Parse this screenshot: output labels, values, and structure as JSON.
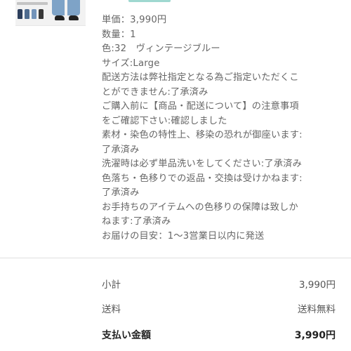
{
  "product": {
    "thumbnail_icon": "jeans-product-thumbnail",
    "unit_price": "単価：3,990円",
    "quantity": "数量：1",
    "color": "色:32　ヴィンテージブルー",
    "size": "サイズ:Large",
    "notes": [
      "配送方法は弊社指定となる為ご指定いただくこ",
      "とができません:了承済み",
      "ご購入前に【商品・配送について】の注意事項",
      "をご確認下さい:確認しました",
      "素材・染色の特性上、移染の恐れが御座います:",
      "了承済み",
      "洗濯時は必ず単品洗いをしてください:了承済み",
      "色落ち・色移りでの返品・交換は受けかねます:",
      "了承済み",
      "お手持ちのアイテムへの色移りの保障は致しか",
      "ねます:了承済み"
    ],
    "delivery": "お届けの目安：1〜3営業日以内に発送"
  },
  "summary": {
    "subtotal_label": "小計",
    "subtotal_value": "3,990円",
    "shipping_label": "送料",
    "shipping_value": "送料無料",
    "total_label": "支払い金額",
    "total_value": "3,990円"
  },
  "colors": {
    "accent_teal": "#9fd8d0",
    "text": "#666666",
    "divider": "#e0e0e0"
  }
}
